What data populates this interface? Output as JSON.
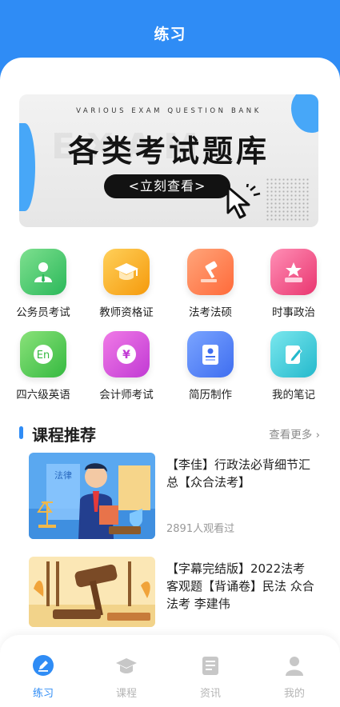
{
  "header": {
    "title": "练习"
  },
  "banner": {
    "subtitle": "VARIOUS EXAM QUESTION BANK",
    "watermark": "EXAM",
    "title": "各类考试题库",
    "cta_label": "<立刻查看>"
  },
  "categories": [
    {
      "label": "公务员考试",
      "icon": "civil-servant-icon",
      "color": "#3cc46a"
    },
    {
      "label": "教师资格证",
      "icon": "graduation-cap-icon",
      "color": "#f7a81b"
    },
    {
      "label": "法考法硕",
      "icon": "gavel-icon",
      "color": "#ff7a45"
    },
    {
      "label": "时事政治",
      "icon": "star-podium-icon",
      "color": "#f2578c"
    },
    {
      "label": "四六级英语",
      "icon": "english-chat-icon",
      "color": "#48c24e"
    },
    {
      "label": "会计师考试",
      "icon": "yen-coin-icon",
      "color": "#d94fd0"
    },
    {
      "label": "简历制作",
      "icon": "resume-icon",
      "color": "#4a7cf6"
    },
    {
      "label": "我的笔记",
      "icon": "notebook-pencil-icon",
      "color": "#36c7d6"
    }
  ],
  "section": {
    "title": "课程推荐",
    "more_label": "查看更多 ›"
  },
  "courses": [
    {
      "title": "【李佳】行政法必背细节汇总【众合法考】",
      "views": "2891人观看过",
      "thumb_text": "法律"
    },
    {
      "title": "【字幕完结版】2022法考客观题【背诵卷】民法 众合法考 李建伟",
      "views": "",
      "thumb_text": ""
    }
  ],
  "tabbar": {
    "tabs": [
      {
        "label": "练习",
        "icon": "practice-icon",
        "active": true
      },
      {
        "label": "课程",
        "icon": "course-cap-icon",
        "active": false
      },
      {
        "label": "资讯",
        "icon": "news-icon",
        "active": false
      },
      {
        "label": "我的",
        "icon": "profile-icon",
        "active": false
      }
    ]
  },
  "colors": {
    "primary": "#2f8cf5",
    "inactive_tab": "#b5b5b5"
  }
}
